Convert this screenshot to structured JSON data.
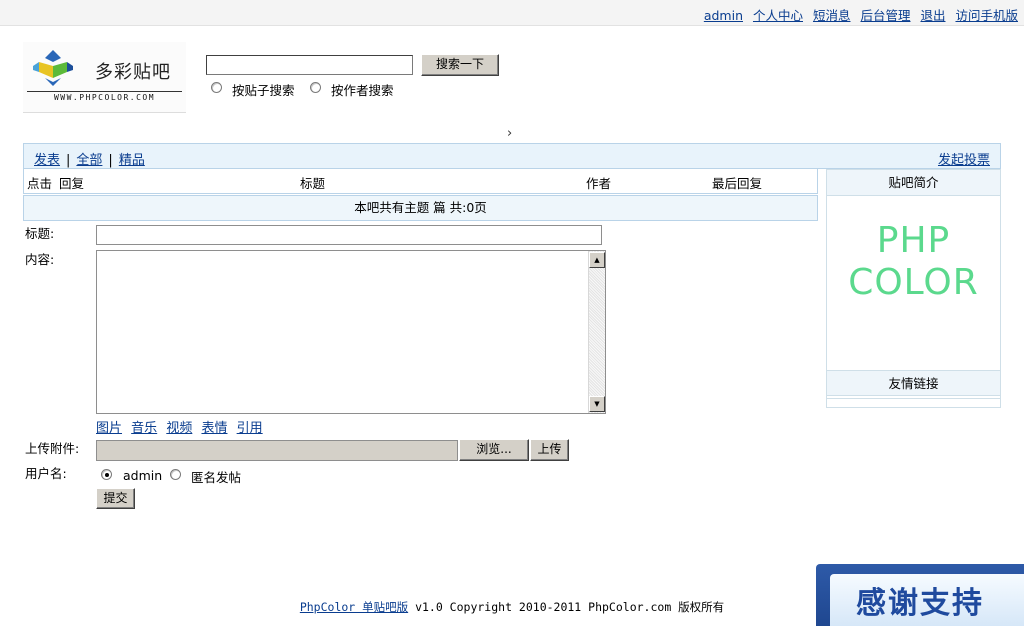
{
  "topnav": {
    "username": "admin",
    "profile": "个人中心",
    "messages": "短消息",
    "admin_panel": "后台管理",
    "logout": "退出",
    "mobile": "访问手机版"
  },
  "logo": {
    "name": "多彩贴吧",
    "url": "WWW.PHPCOLOR.COM"
  },
  "search": {
    "value": "",
    "button": "搜索一下",
    "option_post": "按贴子搜索",
    "option_author": "按作者搜索"
  },
  "chevron": "›",
  "nav": {
    "post": "发表",
    "all": "全部",
    "featured": "精品",
    "separator": "|",
    "vote": "发起投票"
  },
  "table": {
    "headers": {
      "clicks": "点击",
      "replies": "回复",
      "title": "标题",
      "author": "作者",
      "last_reply": "最后回复"
    },
    "empty_text": "本吧共有主题 篇 共:0页"
  },
  "form": {
    "title_label": "标题:",
    "content_label": "内容:",
    "toolbar": [
      "图片",
      "音乐",
      "视频",
      "表情",
      "引用"
    ],
    "attachment_label": "上传附件:",
    "browse": "浏览...",
    "upload": "上传",
    "username_label": "用户名:",
    "user_option": "admin",
    "anon_option": "匿名发帖",
    "submit": "提交"
  },
  "sidebar": {
    "intro": "贴吧简介",
    "logo_line1": "PHP",
    "logo_line2": "COLOR",
    "links": "友情链接"
  },
  "footer": {
    "link": "PhpColor 单贴吧版",
    "text": " v1.0 Copyright 2010-2011 PhpColor.com 版权所有"
  },
  "badge": "感谢支持",
  "colors": {
    "link": "#0a3d8f",
    "nav_bg": "#e8f3fb",
    "logo_green": "#5bd98d",
    "badge_blue": "#1f4a9e"
  }
}
